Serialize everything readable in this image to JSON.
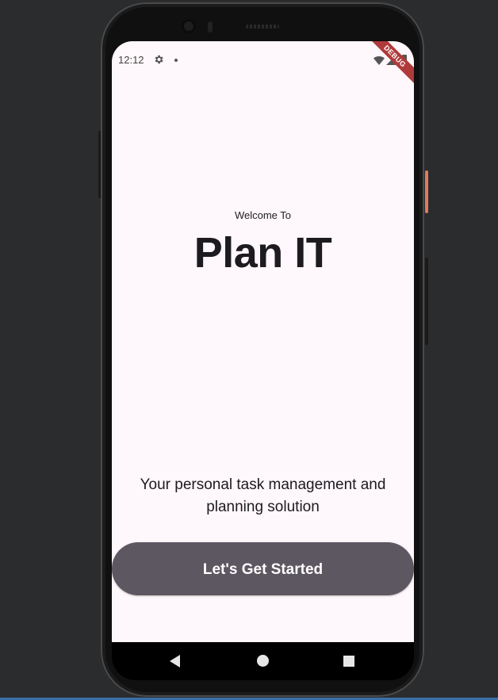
{
  "status_bar": {
    "time": "12:12",
    "icons": [
      "gear-icon",
      "notification-dot-icon",
      "wifi-icon",
      "signal-icon",
      "battery-icon"
    ]
  },
  "debug_banner": "DEBUG",
  "welcome": {
    "subtitle": "Welcome To",
    "title": "Plan IT",
    "tagline": "Your personal task management and planning solution",
    "cta_label": "Let's Get Started"
  },
  "nav_bar": {
    "icons": [
      "back-icon",
      "home-icon",
      "recents-icon"
    ]
  },
  "colors": {
    "screen_background": "#fef7fb",
    "button_background": "#5d5761",
    "button_text": "#ffffff",
    "title_text": "#1d1b20",
    "debug_banner": "#b03a3a"
  }
}
